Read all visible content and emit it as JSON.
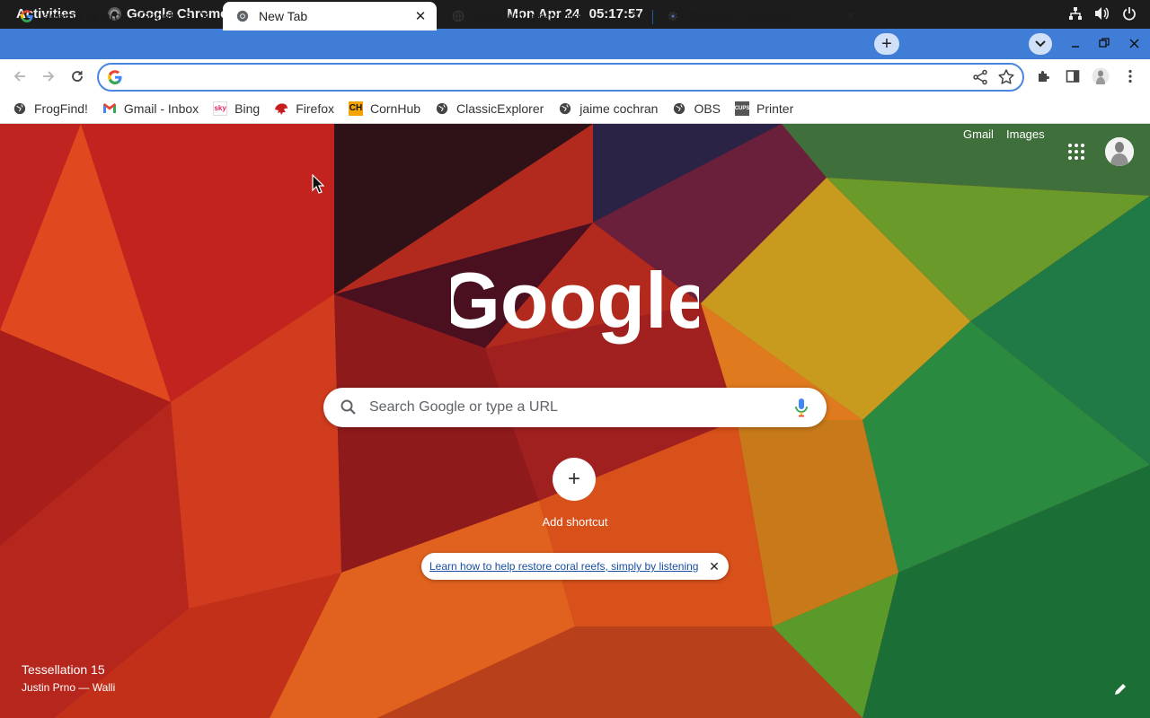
{
  "topbar": {
    "activities": "Activities",
    "app_name": "Google Chrome",
    "date": "Mon Apr 24",
    "time": "05:17:57",
    "tray_icons": [
      "network-icon",
      "volume-icon",
      "power-icon"
    ]
  },
  "tabs": [
    {
      "title": "aqemu for arch - Google Search",
      "icon": "google-g-icon",
      "active": false
    },
    {
      "title": "New Tab",
      "icon": "chrome-icon",
      "active": true
    },
    {
      "title": "www.virtualbox.org",
      "icon": "globe-icon",
      "active": false
    },
    {
      "title": "Settings - Security",
      "icon": "gear-icon",
      "active": false
    }
  ],
  "toolbar": {
    "address_value": "",
    "address_placeholder": ""
  },
  "bookmarks": [
    {
      "label": "FrogFind!",
      "icon": "globe-icon"
    },
    {
      "label": "Gmail - Inbox",
      "icon": "gmail-icon"
    },
    {
      "label": "Bing",
      "icon": "sky-icon"
    },
    {
      "label": "Firefox",
      "icon": "firefox-icon"
    },
    {
      "label": "CornHub",
      "icon": "ch-icon"
    },
    {
      "label": "ClassicExplorer",
      "icon": "globe-icon"
    },
    {
      "label": "jaime cochran",
      "icon": "globe-icon"
    },
    {
      "label": "OBS",
      "icon": "globe-icon"
    },
    {
      "label": "Printer",
      "icon": "cups-icon"
    }
  ],
  "ntp": {
    "gmail_link": "Gmail",
    "images_link": "Images",
    "logo_text": "Google",
    "search_placeholder": "Search Google or type a URL",
    "add_shortcut_label": "Add shortcut",
    "promo_text": "Learn how to help restore coral reefs, simply by listening",
    "background_title": "Tessellation 15",
    "background_credit": "Justin Prno — Walli"
  },
  "colors": {
    "tabstrip": "#3f7dd6",
    "omnibox_border": "#4a85e0",
    "topbar": "#1c1c1c"
  }
}
